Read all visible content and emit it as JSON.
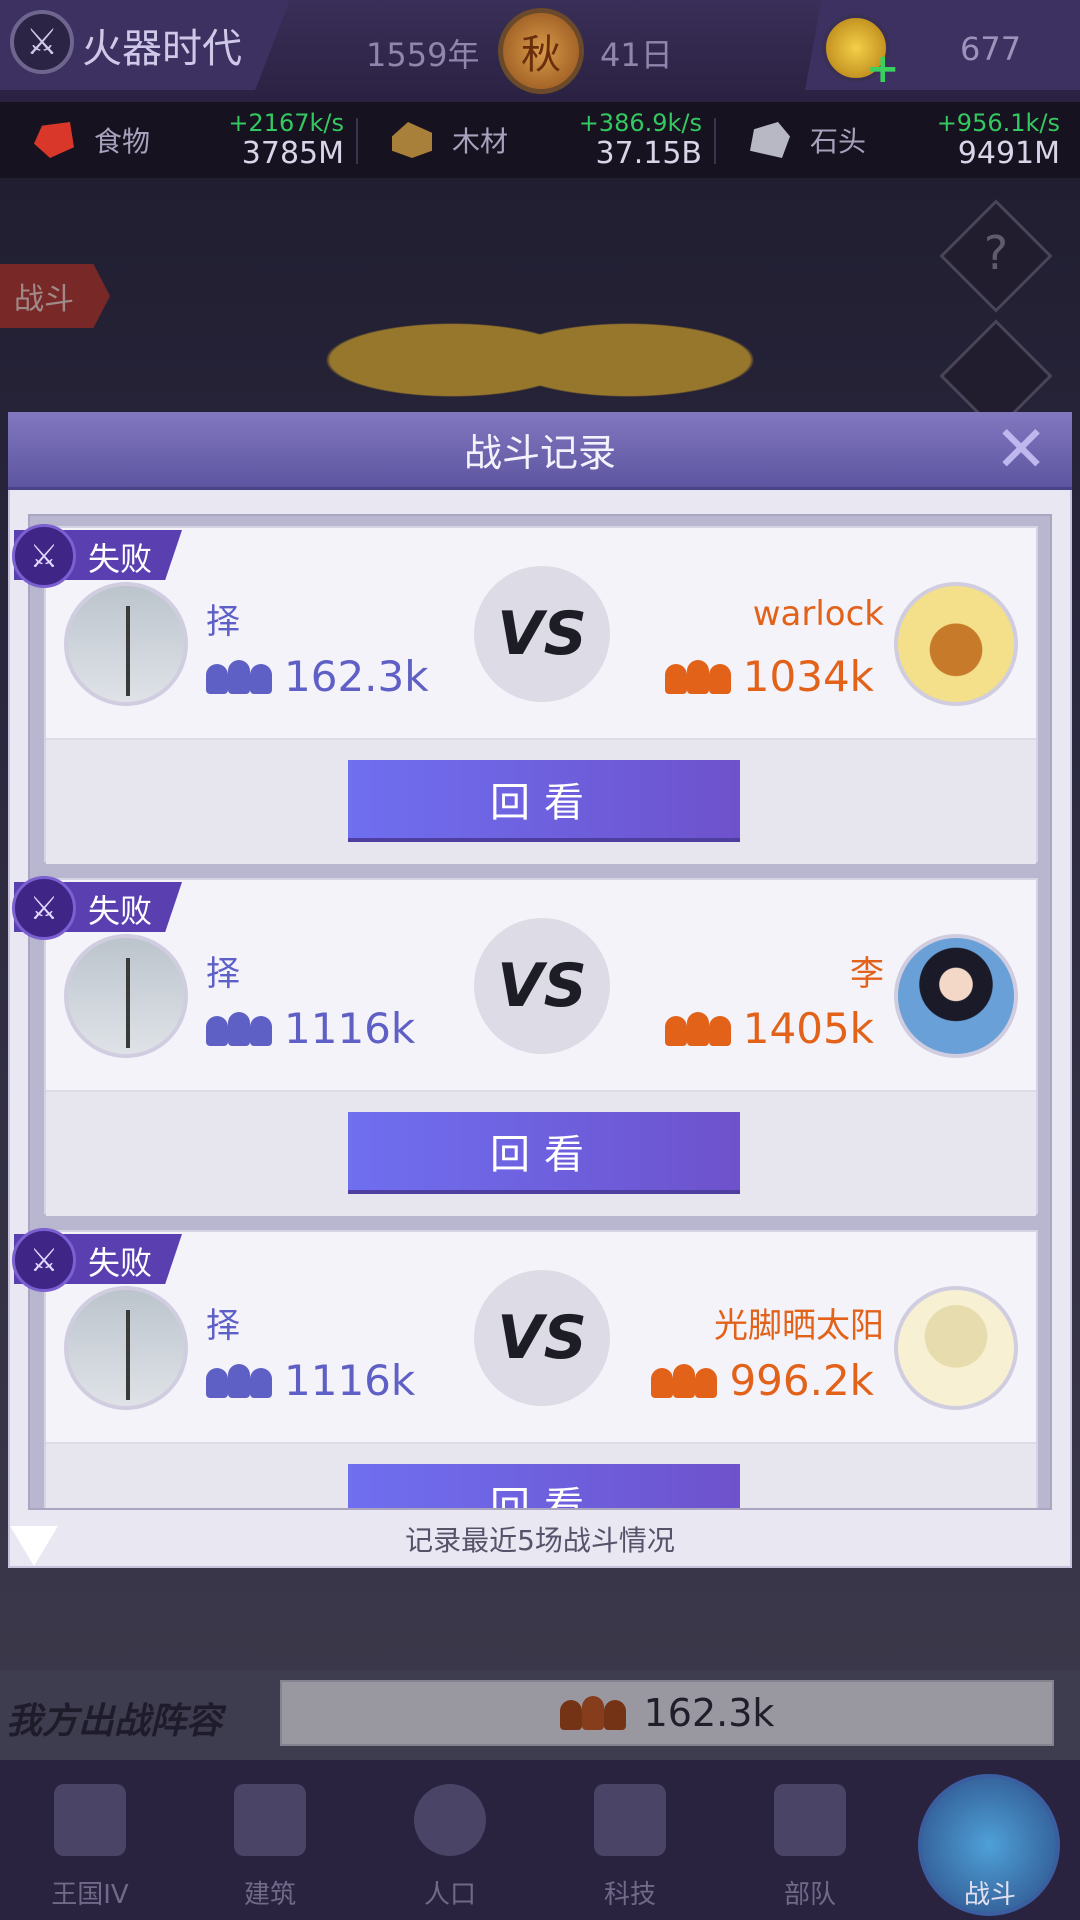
{
  "topbar": {
    "era_name": "火器时代",
    "year": "1559年",
    "season": "秋",
    "day": "41日",
    "gems": "677"
  },
  "resources": [
    {
      "name": "食物",
      "rate": "+2167k/s",
      "amount": "3785M",
      "icon": "meat-icon",
      "color": "#d8372a"
    },
    {
      "name": "木材",
      "rate": "+386.9k/s",
      "amount": "37.15B",
      "icon": "wood-icon",
      "color": "#a8803a"
    },
    {
      "name": "石头",
      "rate": "+956.1k/s",
      "amount": "9491M",
      "icon": "stone-icon",
      "color": "#b8b8c4"
    }
  ],
  "scene": {
    "battle_tag": "战斗",
    "help_label": "?",
    "lineup_label": "我方出战阵容",
    "lineup_power": "162.3k"
  },
  "dialog": {
    "title": "战斗记录",
    "close_label": "✕",
    "footer": "记录最近5场战斗情况",
    "records": [
      {
        "result": "失败",
        "me_name": "择",
        "me_power": "162.3k",
        "vs": "VS",
        "opp_name": "warlock",
        "opp_power": "1034k",
        "replay": "回看"
      },
      {
        "result": "失败",
        "me_name": "择",
        "me_power": "1116k",
        "vs": "VS",
        "opp_name": "李",
        "opp_power": "1405k",
        "replay": "回看"
      },
      {
        "result": "失败",
        "me_name": "择",
        "me_power": "1116k",
        "vs": "VS",
        "opp_name": "光脚晒太阳",
        "opp_power": "996.2k",
        "replay": "回看"
      }
    ]
  },
  "nav": [
    {
      "label": "王国IV",
      "icon": "castle-icon"
    },
    {
      "label": "建筑",
      "icon": "house-icon"
    },
    {
      "label": "人口",
      "icon": "person-icon"
    },
    {
      "label": "科技",
      "icon": "book-icon"
    },
    {
      "label": "部队",
      "icon": "banner-icon"
    },
    {
      "label": "战斗",
      "icon": "crossed-swords-icon",
      "active": true
    }
  ],
  "colors": {
    "accent_purple": "#6e52cc",
    "my_name": "#5f60c6",
    "opponent_name": "#e2621a",
    "gain_green": "#34c860"
  }
}
